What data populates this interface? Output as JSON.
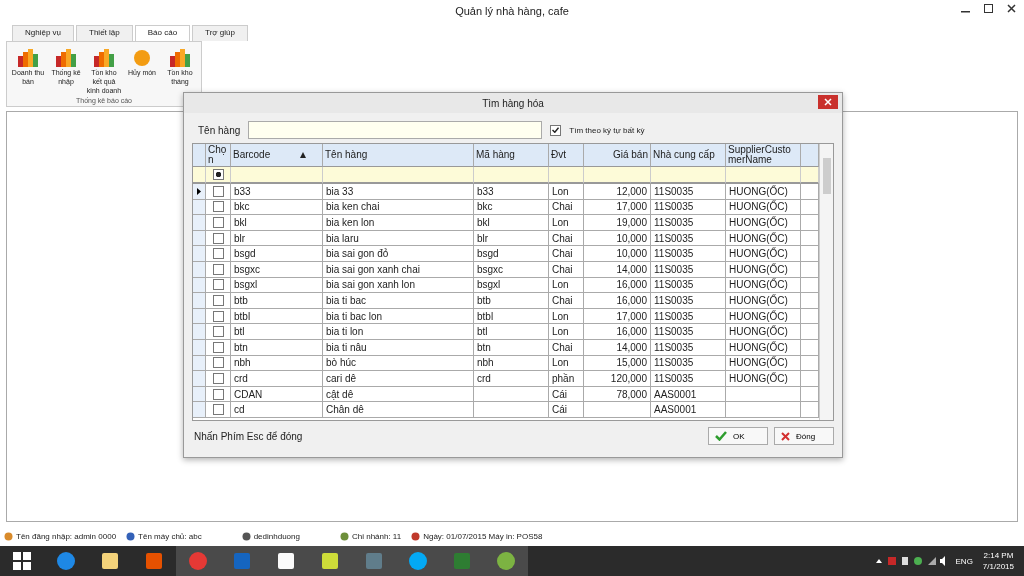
{
  "window": {
    "title": "Quản lý nhà hàng, cafe"
  },
  "menu_tabs": [
    {
      "label": "Nghiệp vụ",
      "selected": false
    },
    {
      "label": "Thiết lập",
      "selected": false
    },
    {
      "label": "Báo cáo",
      "selected": true
    },
    {
      "label": "Trợ giúp",
      "selected": false
    }
  ],
  "ribbon": {
    "group_label": "Thống kê báo cáo",
    "items": [
      {
        "label": "Doanh thu bán",
        "kind": "chart"
      },
      {
        "label": "Thống kê nhập",
        "kind": "chart"
      },
      {
        "label": "Tồn kho kết quả kinh doanh",
        "kind": "chart"
      },
      {
        "label": "Hủy món",
        "kind": "coin"
      },
      {
        "label": "Tồn kho tháng",
        "kind": "chart"
      }
    ]
  },
  "dialog": {
    "title": "Tìm hàng hóa",
    "search_label": "Tên hàng",
    "any_char": {
      "label": "Tìm theo ký tự bất kỳ",
      "checked": true
    },
    "select_column": "Chọn",
    "columns": [
      "Barcode",
      "Tên hàng",
      "Mã hàng",
      "Đvt",
      "Giá bán",
      "Nhà cung cấp",
      "SupplierCustomerName"
    ],
    "filter_checkbox": {
      "checked": true
    },
    "rows": [
      {
        "selected": true,
        "checked": false,
        "cells": [
          "b33",
          "bia  33",
          "b33",
          "Lon",
          "12,000",
          "11S0035",
          "HUONG(ỐC)"
        ]
      },
      {
        "selected": false,
        "checked": false,
        "cells": [
          "bkc",
          "bia ken chai",
          "bkc",
          "Chai",
          "17,000",
          "11S0035",
          "HUONG(ỐC)"
        ]
      },
      {
        "selected": false,
        "checked": false,
        "cells": [
          "bkl",
          "bia ken lon",
          "bkl",
          "Lon",
          "19,000",
          "11S0035",
          "HUONG(ỐC)"
        ]
      },
      {
        "selected": false,
        "checked": false,
        "cells": [
          "blr",
          "bia laru",
          "blr",
          "Chai",
          "10,000",
          "11S0035",
          "HUONG(ỐC)"
        ]
      },
      {
        "selected": false,
        "checked": false,
        "cells": [
          "bsgd",
          "bia sai gon đỏ",
          "bsgd",
          "Chai",
          "10,000",
          "11S0035",
          "HUONG(ỐC)"
        ]
      },
      {
        "selected": false,
        "checked": false,
        "cells": [
          "bsgxc",
          "bia sai gon xanh chai",
          "bsgxc",
          "Chai",
          "14,000",
          "11S0035",
          "HUONG(ỐC)"
        ]
      },
      {
        "selected": false,
        "checked": false,
        "cells": [
          "bsgxl",
          "bia sai gon xanh lon",
          "bsgxl",
          "Lon",
          "16,000",
          "11S0035",
          "HUONG(ỐC)"
        ]
      },
      {
        "selected": false,
        "checked": false,
        "cells": [
          "btb",
          "bia ti bac",
          "btb",
          "Chai",
          "16,000",
          "11S0035",
          "HUONG(ỐC)"
        ]
      },
      {
        "selected": false,
        "checked": false,
        "cells": [
          "btbl",
          "bia ti bac lon",
          "btbl",
          "Lon",
          "17,000",
          "11S0035",
          "HUONG(ỐC)"
        ]
      },
      {
        "selected": false,
        "checked": false,
        "cells": [
          "btl",
          "bia ti lon",
          "btl",
          "Lon",
          "16,000",
          "11S0035",
          "HUONG(ỐC)"
        ]
      },
      {
        "selected": false,
        "checked": false,
        "cells": [
          "btn",
          "bia ti nâu",
          "btn",
          "Chai",
          "14,000",
          "11S0035",
          "HUONG(ỐC)"
        ]
      },
      {
        "selected": false,
        "checked": false,
        "cells": [
          "nbh",
          "bò húc",
          "nbh",
          "Lon",
          "15,000",
          "11S0035",
          "HUONG(ỐC)"
        ]
      },
      {
        "selected": false,
        "checked": false,
        "cells": [
          "crd",
          "cari dê",
          "crd",
          "phần",
          "120,000",
          "11S0035",
          "HUONG(ỐC)"
        ]
      },
      {
        "selected": false,
        "checked": false,
        "cells": [
          "CDAN",
          "cật dê",
          "",
          "Cái",
          "78,000",
          "AAS0001",
          ""
        ]
      },
      {
        "selected": false,
        "checked": false,
        "cells": [
          "cd",
          "Chân dê",
          "",
          "Cái",
          "",
          "AAS0001",
          ""
        ]
      }
    ],
    "hint": "Nhấn Phím Esc để đóng",
    "buttons": [
      {
        "label": "OK",
        "kind": "ok"
      },
      {
        "label": "Đóng",
        "kind": "close"
      }
    ]
  },
  "status_bar": [
    {
      "kind": "user",
      "text": "Tên đăng nhập:  admin  0000"
    },
    {
      "kind": "server",
      "text": "Tên máy chủ:  abc"
    },
    {
      "kind": "db",
      "text": "dedinhduong"
    },
    {
      "kind": "branch",
      "text": "Chi nhánh:  11"
    },
    {
      "kind": "date",
      "text": "Ngày:  01/07/2015  Máy in: POS58"
    }
  ],
  "taskbar": {
    "language": "ENG",
    "time": "2:14 PM",
    "date": "7/1/2015"
  }
}
